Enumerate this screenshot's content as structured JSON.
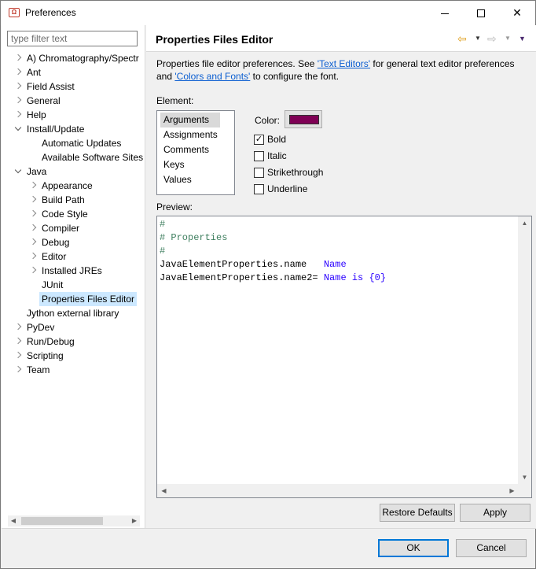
{
  "window": {
    "title": "Preferences",
    "app_icon": "eclipse-preferences-icon"
  },
  "filter": {
    "placeholder": "type filter text",
    "value": ""
  },
  "tree": {
    "items": [
      {
        "label": "A) Chromatography/Spectr",
        "state": "collapsed",
        "level": 0
      },
      {
        "label": "Ant",
        "state": "collapsed",
        "level": 0
      },
      {
        "label": "Field Assist",
        "state": "collapsed",
        "level": 0
      },
      {
        "label": "General",
        "state": "collapsed",
        "level": 0
      },
      {
        "label": "Help",
        "state": "collapsed",
        "level": 0
      },
      {
        "label": "Install/Update",
        "state": "expanded",
        "level": 0
      },
      {
        "label": "Automatic Updates",
        "state": "leaf",
        "level": 1
      },
      {
        "label": "Available Software Sites",
        "state": "leaf",
        "level": 1
      },
      {
        "label": "Java",
        "state": "expanded",
        "level": 0
      },
      {
        "label": "Appearance",
        "state": "collapsed",
        "level": 1
      },
      {
        "label": "Build Path",
        "state": "collapsed",
        "level": 1
      },
      {
        "label": "Code Style",
        "state": "collapsed",
        "level": 1
      },
      {
        "label": "Compiler",
        "state": "collapsed",
        "level": 1
      },
      {
        "label": "Debug",
        "state": "collapsed",
        "level": 1
      },
      {
        "label": "Editor",
        "state": "collapsed",
        "level": 1
      },
      {
        "label": "Installed JREs",
        "state": "collapsed",
        "level": 1
      },
      {
        "label": "JUnit",
        "state": "leaf",
        "level": 1
      },
      {
        "label": "Properties Files Editor",
        "state": "leaf",
        "level": 1,
        "selected": true
      },
      {
        "label": "Jython external library",
        "state": "leaf",
        "level": 0
      },
      {
        "label": "PyDev",
        "state": "collapsed",
        "level": 0
      },
      {
        "label": "Run/Debug",
        "state": "collapsed",
        "level": 0
      },
      {
        "label": "Scripting",
        "state": "collapsed",
        "level": 0
      },
      {
        "label": "Team",
        "state": "collapsed",
        "level": 0
      }
    ]
  },
  "page": {
    "title": "Properties Files Editor",
    "desc_part1": "Properties file editor preferences. See ",
    "desc_link1": "'Text Editors'",
    "desc_part2": " for general text editor preferences and ",
    "desc_link2": "'Colors and Fonts'",
    "desc_part3": " to configure the font.",
    "element_label": "Element:",
    "elements": [
      "Arguments",
      "Assignments",
      "Comments",
      "Keys",
      "Values"
    ],
    "selected_element": "Arguments",
    "color_label": "Color:",
    "color_value": "#7f0055",
    "options": [
      {
        "label": "Bold",
        "checked": true
      },
      {
        "label": "Italic",
        "checked": false
      },
      {
        "label": "Strikethrough",
        "checked": false
      },
      {
        "label": "Underline",
        "checked": false
      }
    ],
    "preview_label": "Preview:",
    "preview_lines": [
      [
        {
          "t": "#",
          "k": "comment"
        }
      ],
      [
        {
          "t": "# Properties",
          "k": "comment"
        }
      ],
      [
        {
          "t": "#",
          "k": "comment"
        }
      ],
      [
        {
          "t": "JavaElementProperties.name   ",
          "k": "key"
        },
        {
          "t": "Name",
          "k": "val"
        }
      ],
      [
        {
          "t": "JavaElementProperties.name2= ",
          "k": "key"
        },
        {
          "t": "Name is {0}",
          "k": "val"
        }
      ]
    ],
    "restore_defaults": "Restore Defaults",
    "apply": "Apply"
  },
  "dialog": {
    "ok": "OK",
    "cancel": "Cancel"
  },
  "colors": {
    "comment": "#3f7f5f",
    "key": "#000000",
    "value": "#2a00ff",
    "selection": "#cce8ff",
    "accent": "#0078d7"
  }
}
